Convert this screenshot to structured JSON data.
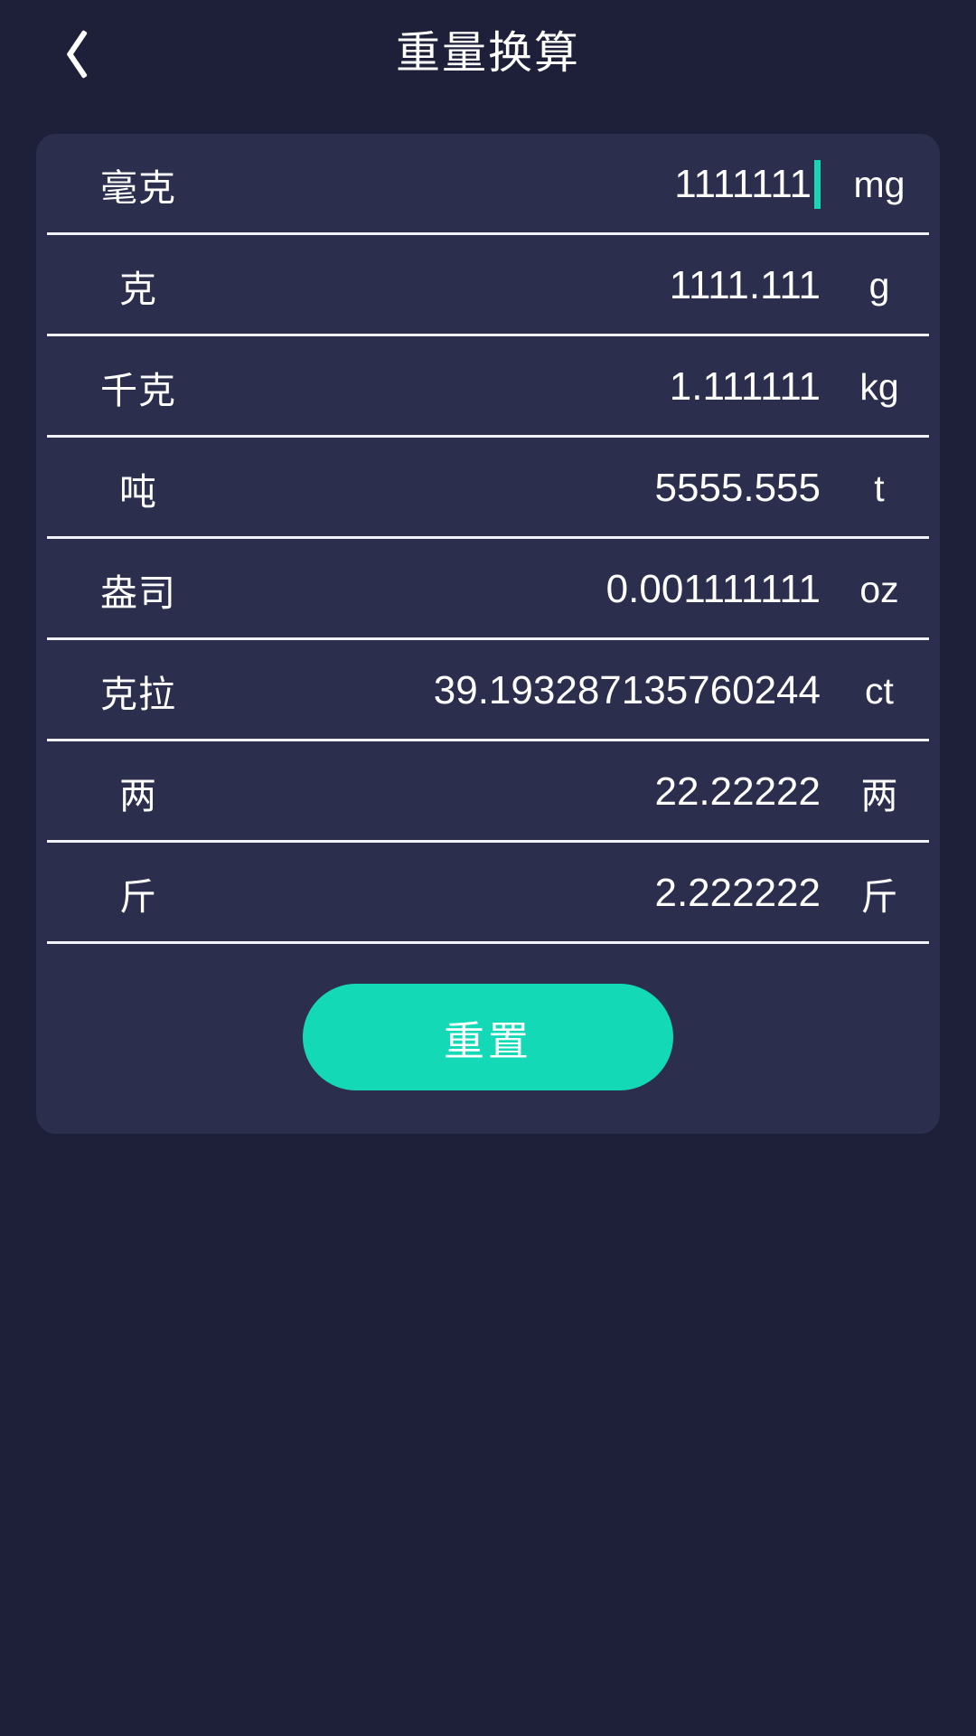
{
  "header": {
    "title": "重量换算",
    "back_icon": "chevron-left-icon"
  },
  "theme": {
    "background": "#1d2038",
    "card_background": "#2b2e4c",
    "accent": "#14d9b6",
    "caret": "#18d6b4",
    "text": "#ffffff",
    "separator": "#f2f3f8"
  },
  "converter": {
    "focused_row_index": 0,
    "rows": [
      {
        "label": "毫克",
        "value": "1111111",
        "abbr": "mg",
        "placeholder": "0"
      },
      {
        "label": "克",
        "value": "1111.111",
        "abbr": "g",
        "placeholder": "0"
      },
      {
        "label": "千克",
        "value": "1.111111",
        "abbr": "kg",
        "placeholder": "0"
      },
      {
        "label": "吨",
        "value": "5555.555",
        "abbr": "t",
        "placeholder": "0"
      },
      {
        "label": "盎司",
        "value": "0.001111111",
        "abbr": "oz",
        "placeholder": "0"
      },
      {
        "label": "克拉",
        "value": "39.193287135760244",
        "abbr": "ct",
        "placeholder": "0"
      },
      {
        "label": "两",
        "value": "22.22222",
        "abbr": "两",
        "placeholder": "0"
      },
      {
        "label": "斤",
        "value": "2.222222",
        "abbr": "斤",
        "placeholder": "0"
      }
    ]
  },
  "actions": {
    "reset_label": "重置"
  }
}
